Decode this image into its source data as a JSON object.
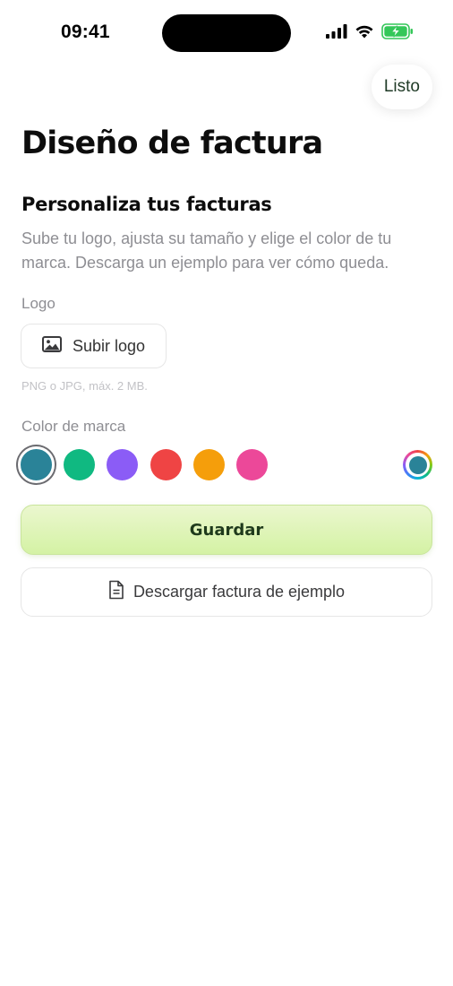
{
  "status_bar": {
    "time": "09:41"
  },
  "header": {
    "done_label": "Listo"
  },
  "page": {
    "title": "Diseño de factura",
    "section_title": "Personaliza tus facturas",
    "section_description": "Sube tu logo, ajusta su tamaño y elige el color de tu marca. Descarga un ejemplo para ver cómo queda."
  },
  "logo": {
    "label": "Logo",
    "upload_label": "Subir logo",
    "upload_icon": "image-icon",
    "hint": "PNG o JPG, máx. 2 MB."
  },
  "brand_color": {
    "label": "Color de marca",
    "swatches": [
      {
        "name": "teal",
        "color": "#2a8398",
        "selected": true
      },
      {
        "name": "green",
        "color": "#10b981",
        "selected": false
      },
      {
        "name": "purple",
        "color": "#8b5cf6",
        "selected": false
      },
      {
        "name": "red",
        "color": "#ef4444",
        "selected": false
      },
      {
        "name": "orange",
        "color": "#f59e0b",
        "selected": false
      },
      {
        "name": "pink",
        "color": "#ec4899",
        "selected": false
      }
    ],
    "custom_icon": "color-picker-icon",
    "custom_color": "#2a8398"
  },
  "actions": {
    "save_label": "Guardar",
    "download_label": "Descargar factura de ejemplo",
    "download_icon": "document-icon"
  },
  "colors": {
    "save_gradient_top": "#ebf7cf",
    "save_gradient_bottom": "#d4f2a4",
    "battery_charging": "#34c759"
  }
}
